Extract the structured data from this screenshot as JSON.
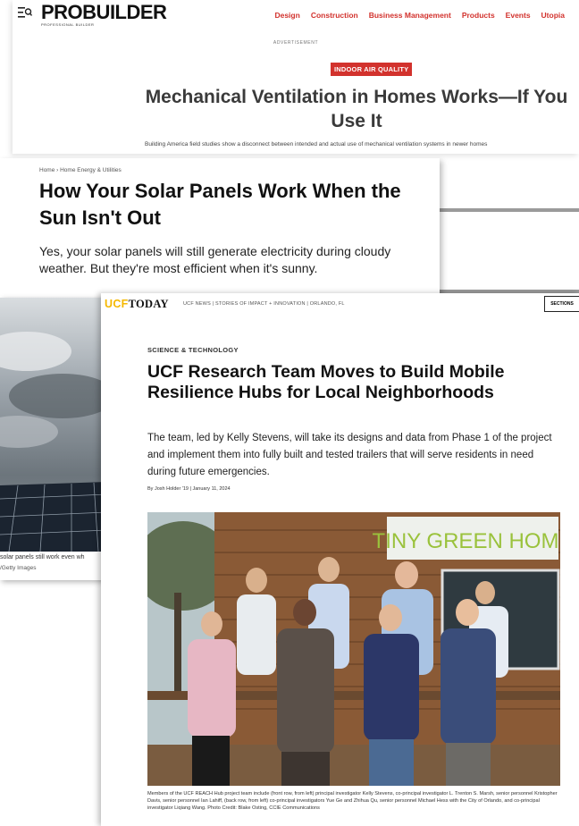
{
  "probuilder": {
    "logo": "PROBUILDER",
    "logo_sub": "PROFESSIONAL BUILDER",
    "nav": [
      "Design",
      "Construction",
      "Business Management",
      "Products",
      "Events",
      "Utopia"
    ],
    "advertisement": "ADVERTISEMENT",
    "tag": "INDOOR AIR QUALITY",
    "title": "Mechanical Ventilation in Homes Works—If You Use It",
    "dek": "Building America field studies show a disconnect between intended and actual use of mechanical ventilation systems in newer homes",
    "accent": "#d2322d"
  },
  "solar": {
    "breadcrumb": "Home › Home Energy & Utilities",
    "title": "How Your Solar Panels Work When the Sun Isn't Out",
    "dek": "Yes, your solar panels will still generate electricity during cloudy weather. But they're most efficient when it's sunny."
  },
  "solar_photo": {
    "caption": "solar panels still work even wh",
    "credit": "/Getty Images"
  },
  "ucf": {
    "brand_ucf": "UCF",
    "brand_today": "TODAY",
    "tagline": "UCF NEWS | STORIES OF IMPACT + INNOVATION | ORLANDO, FL",
    "sections_button": "SECTIONS",
    "kicker": "SCIENCE & TECHNOLOGY",
    "title": "UCF Research Team Moves to Build Mobile Resilience Hubs for Local Neighborhoods",
    "dek": "The team, led by Kelly Stevens, will take its designs and data from Phase 1 of the project and implement them into fully built and tested trailers that will serve residents in need during future emergencies.",
    "byline": "By Josh Holder '19  |  January 11, 2024",
    "sign_text": "TINY GREEN HOME",
    "caption": "Members of the UCF REACH Hub project team include (front row, from left) principal investigator Kelly Stevens, co-principal investigator L. Trenton S. Marsh, senior personnel Kristopher Davis, senior personnel Ian Lahiff, (back row, from left) co-principal investigators Yue Ge and Zhihua Qu, senior personnel Michael Hess with the City of Orlando, and co-principal investigator Liqiang Wang. Photo Credit: Blake Osting, CCIE Communications",
    "brand_color": "#f5b800"
  }
}
